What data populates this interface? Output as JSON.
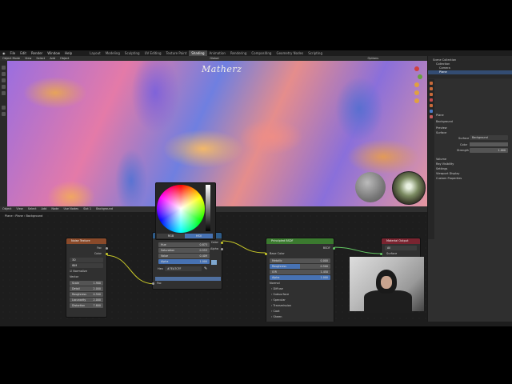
{
  "menu": {
    "items": [
      "File",
      "Edit",
      "Render",
      "Window",
      "Help"
    ],
    "workspaces": [
      "Layout",
      "Modeling",
      "Sculpting",
      "UV Editing",
      "Texture Paint",
      "Shading",
      "Animation",
      "Rendering",
      "Compositing",
      "Geometry Nodes",
      "Scripting"
    ],
    "active_workspace": "Shading"
  },
  "viewport": {
    "mode": "Object Mode",
    "header_items": [
      "View",
      "Select",
      "Add",
      "Object"
    ],
    "shading": "Global",
    "title": "Matherz",
    "options": "Options"
  },
  "outliner": {
    "rows": [
      "Scene Collection",
      "Collection",
      "Camera",
      "Plane"
    ]
  },
  "properties": {
    "object": "Plane",
    "section": "Surface",
    "preview": "Preview",
    "surface_label": "Surface",
    "surface_value": "Background",
    "color_label": "Color",
    "strength_label": "Strength",
    "strength_value": "1.000",
    "panels": [
      "Volume",
      "Ray Visibility",
      "Settings",
      "Viewport Display",
      "Custom Properties"
    ]
  },
  "node_editor": {
    "header_items": [
      "Object",
      "View",
      "Select",
      "Add",
      "Node",
      "Use Nodes"
    ],
    "slot": "Slot 1",
    "material": "Background",
    "breadcrumb": [
      "Plane",
      "Plane",
      "Background"
    ]
  },
  "noise_node": {
    "title": "Noise Texture",
    "out_fac": "Fac",
    "out_color": "Color",
    "dim": "3D",
    "type": "fBM",
    "normalize": "Normalize",
    "vector": "Vector",
    "fields": [
      {
        "k": "Scale",
        "v": "1.900"
      },
      {
        "k": "Detail",
        "v": "2.000"
      },
      {
        "k": "Roughness",
        "v": "0.500"
      },
      {
        "k": "Lacunarity",
        "v": "2.000"
      },
      {
        "k": "Distortion",
        "v": "7.800"
      }
    ]
  },
  "color_picker": {
    "tabs": [
      "RGB",
      "HSV"
    ],
    "active_tab": "HSV",
    "fields": [
      {
        "k": "Hue",
        "v": "0.873"
      },
      {
        "k": "Saturation",
        "v": "0.553"
      },
      {
        "k": "Value",
        "v": "0.409"
      },
      {
        "k": "Alpha",
        "v": "1.000"
      }
    ],
    "hex_label": "Hex",
    "hex": "#7EA7CFF",
    "fac": "Fac"
  },
  "bsdf_node": {
    "title": "Principled BSDF",
    "out": "BSDF",
    "base_color": "Base Color",
    "fields": [
      {
        "k": "Metallic",
        "v": "0.000"
      },
      {
        "k": "Roughness",
        "v": "0.500"
      },
      {
        "k": "IOR",
        "v": "1.450"
      },
      {
        "k": "Alpha",
        "v": "1.000"
      }
    ],
    "normal": "Normal",
    "panels": [
      "Diffuse",
      "Subsurface",
      "Specular",
      "Transmission",
      "Coat",
      "Sheen"
    ]
  },
  "output_node": {
    "title": "Material Output",
    "target": "All",
    "surface": "Surface"
  },
  "ramp": {
    "color_out": "Color",
    "alpha_out": "Alpha"
  },
  "colors": {
    "noise_header": "#8a4a2a",
    "bsdf_header": "#3b7a2f",
    "output_header": "#7a2430",
    "ramp_header": "#2d5c8a",
    "socket_yellow": "#c7c729",
    "socket_green": "#63c763",
    "socket_purple": "#6363c7",
    "socket_gray": "#a1a1a1",
    "field_blue": "#4772b3"
  }
}
